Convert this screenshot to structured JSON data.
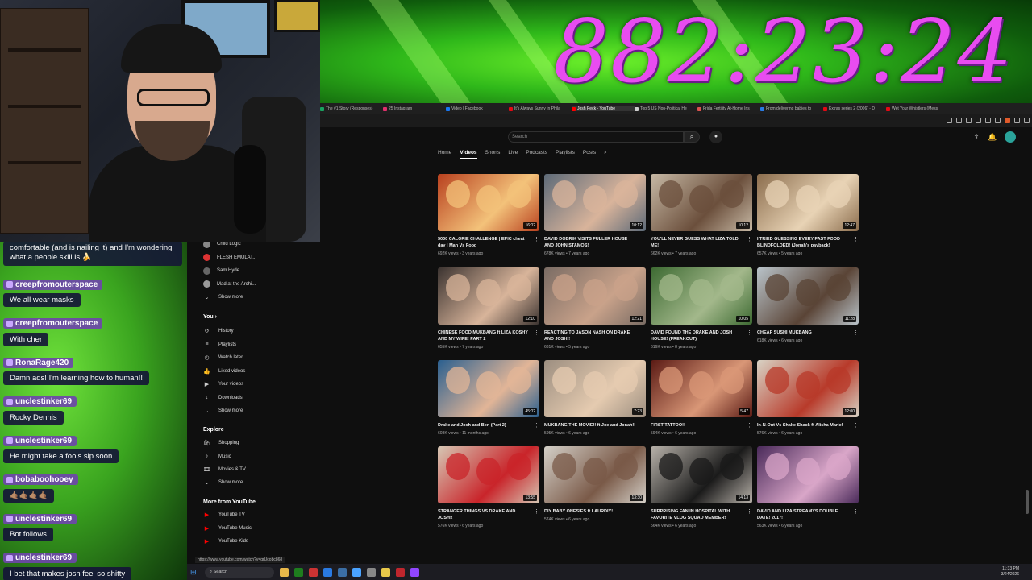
{
  "stream": {
    "timer": "882:23:24"
  },
  "chat": {
    "first_message": "comfortable (and is nailing it) and I'm wondering what a people skill is",
    "first_emote": "🍌",
    "messages": [
      {
        "user": "creepfromouterspace",
        "text": "We all wear masks"
      },
      {
        "user": "creepfromouterspace",
        "text": "With cher"
      },
      {
        "user": "RonaRage420",
        "text": "Damn ads! I'm learning how to human!!"
      },
      {
        "user": "unclestinker69",
        "text": "Rocky Dennis"
      },
      {
        "user": "unclestinker69",
        "text": "He might take a fools sip soon"
      },
      {
        "user": "bobaboohooey",
        "text": "🤙🏽🤙🏽🤙🏽🤙🏽"
      },
      {
        "user": "unclestinker69",
        "text": "Bot follows"
      },
      {
        "user": "unclestinker69",
        "text": "I bet that makes josh feel so shitty"
      }
    ]
  },
  "browser": {
    "tabs": [
      {
        "label": "The #1 Story (Responses)",
        "color": "#1aa260"
      },
      {
        "label": "25 Instagram",
        "color": "#e1306c"
      },
      {
        "label": "Video | Facebook",
        "color": "#1877f2"
      },
      {
        "label": "It's Always Sunny In Phila",
        "color": "#e50914"
      },
      {
        "label": "Josh Peck - YouTube",
        "color": "#ff0000",
        "active": true
      },
      {
        "label": "Top 5 US Non-Political He",
        "color": "#cccccc"
      },
      {
        "label": "Frida Fertility At-Home Ins",
        "color": "#d9534f"
      },
      {
        "label": "From delivering babies to",
        "color": "#2a7ae2"
      },
      {
        "label": "Extras series 2 (2006) - D",
        "color": "#e50914"
      },
      {
        "label": "Wet Your Whistlers (Mess",
        "color": "#e50914"
      }
    ],
    "status_url": "https://www.youtube.com/watch?v=qrUcobc868"
  },
  "youtube": {
    "search_placeholder": "Search",
    "channel_tabs": [
      "Home",
      "Videos",
      "Shorts",
      "Live",
      "Podcasts",
      "Playlists",
      "Posts"
    ],
    "active_tab": "Videos",
    "sidebar": {
      "subscriptions": [
        {
          "label": "Child Logic",
          "color": "#888"
        },
        {
          "label": "FLESH EMULAT...",
          "color": "#d33"
        },
        {
          "label": "Sam Hyde",
          "color": "#666"
        },
        {
          "label": "Mad at the Archi...",
          "color": "#999"
        }
      ],
      "subs_show_more": "Show more",
      "you_heading": "You",
      "you_items": [
        {
          "icon": "history-icon",
          "glyph": "↺",
          "label": "History"
        },
        {
          "icon": "playlists-icon",
          "glyph": "≡",
          "label": "Playlists"
        },
        {
          "icon": "watch-later-icon",
          "glyph": "◷",
          "label": "Watch later"
        },
        {
          "icon": "liked-icon",
          "glyph": "👍",
          "label": "Liked videos"
        },
        {
          "icon": "your-videos-icon",
          "glyph": "▶",
          "label": "Your videos"
        },
        {
          "icon": "downloads-icon",
          "glyph": "↓",
          "label": "Downloads"
        }
      ],
      "you_show_more": "Show more",
      "explore_heading": "Explore",
      "explore_items": [
        {
          "icon": "shopping-icon",
          "glyph": "🛍",
          "label": "Shopping"
        },
        {
          "icon": "music-icon",
          "glyph": "♪",
          "label": "Music"
        },
        {
          "icon": "movies-icon",
          "glyph": "🎞",
          "label": "Movies & TV"
        }
      ],
      "explore_show_more": "Show more",
      "more_heading": "More from YouTube",
      "more_items": [
        {
          "label": "YouTube TV",
          "color": "#ff0000"
        },
        {
          "label": "YouTube Music",
          "color": "#ff0000"
        },
        {
          "label": "YouTube Kids",
          "color": "#ff0000"
        }
      ]
    },
    "videos": [
      {
        "title": "5000 CALORIE CHALLENGE | EPIC cheat day | Man Vs Food",
        "meta": "692K views • 3 years ago",
        "duration": "16:02",
        "bg": "#b8401e",
        "fg": "#f3c27a"
      },
      {
        "title": "DAVID DOBRIK VISITS FULLER HOUSE AND JOHN STAMOS!",
        "meta": "678K views • 7 years ago",
        "duration": "10:12",
        "bg": "#5d6a78",
        "fg": "#d9b49b"
      },
      {
        "title": "YOU'LL NEVER GUESS WHAT LIZA TOLD ME!",
        "meta": "662K views • 7 years ago",
        "duration": "10:12",
        "bg": "#c7b9a5",
        "fg": "#6b4f3c"
      },
      {
        "title": "I TRIED GUESSING EVERY FAST FOOD BLINDFOLDED! (Jonah's payback)",
        "meta": "657K views • 5 years ago",
        "duration": "12:47",
        "bg": "#8b6d4d",
        "fg": "#e8d3b5"
      },
      {
        "title": "CHINESE FOOD MUKBANG ft LIZA KOSHY AND MY WIFE! PART 2",
        "meta": "655K views • 7 years ago",
        "duration": "12:10",
        "bg": "#3b3330",
        "fg": "#d8b49a"
      },
      {
        "title": "REACTING TO JASON NASH ON DRAKE AND JOSH!!",
        "meta": "631K views • 5 years ago",
        "duration": "12:21",
        "bg": "#7a6c64",
        "fg": "#c9a28a"
      },
      {
        "title": "DAVID FOUND THE DRAKE AND JOSH HOUSE! (FREAKOUT)",
        "meta": "616K views • 8 years ago",
        "duration": "10:05",
        "bg": "#3d6a32",
        "fg": "#a3b88b"
      },
      {
        "title": "CHEAP SUSHI MUKBANG",
        "meta": "618K views • 6 years ago",
        "duration": "11:28",
        "bg": "#b9c3c9",
        "fg": "#5a4436"
      },
      {
        "title": "Drake and Josh and Ben (Part 2)",
        "meta": "608K views • 11 months ago",
        "duration": "45:02",
        "bg": "#2a5f8f",
        "fg": "#e2b597"
      },
      {
        "title": "MUKBANG THE MOVIE!! ft Joe and Jonah!!",
        "meta": "595K views • 6 years ago",
        "duration": "7:23",
        "bg": "#9c8e80",
        "fg": "#e5cbb0"
      },
      {
        "title": "FIRST TATTOO!!",
        "meta": "594K views • 6 years ago",
        "duration": "5:47",
        "bg": "#5a1a14",
        "fg": "#d99777"
      },
      {
        "title": "In-N-Out Vs Shake Shack ft Alisha Marie!",
        "meta": "576K views • 6 years ago",
        "duration": "12:00",
        "bg": "#d8d2c4",
        "fg": "#b83a2a"
      },
      {
        "title": "STRANGER THINGS VS DRAKE AND JOSH!!",
        "meta": "576K views • 6 years ago",
        "duration": "13:55",
        "bg": "#d6c7b4",
        "fg": "#c9242a"
      },
      {
        "title": "DIY BABY ONESIES ft LAURDIY!",
        "meta": "574K views • 6 years ago",
        "duration": "13:30",
        "bg": "#d4d0c8",
        "fg": "#7a5a48"
      },
      {
        "title": "SURPRISING FAN IN HOSPITAL WITH FAVORITE VLOG SQUAD MEMBER!",
        "meta": "564K views • 6 years ago",
        "duration": "14:13",
        "bg": "#b8b2aa",
        "fg": "#1a1a1a"
      },
      {
        "title": "DAVID AND LIZA STREAMYS DOUBLE DATE! 2017!",
        "meta": "563K views • 6 years ago",
        "duration": "",
        "bg": "#4a2a5a",
        "fg": "#d9a6c8"
      }
    ]
  },
  "taskbar": {
    "search_placeholder": "Search",
    "time": "11:33 PM",
    "date": "3/24/2026"
  }
}
